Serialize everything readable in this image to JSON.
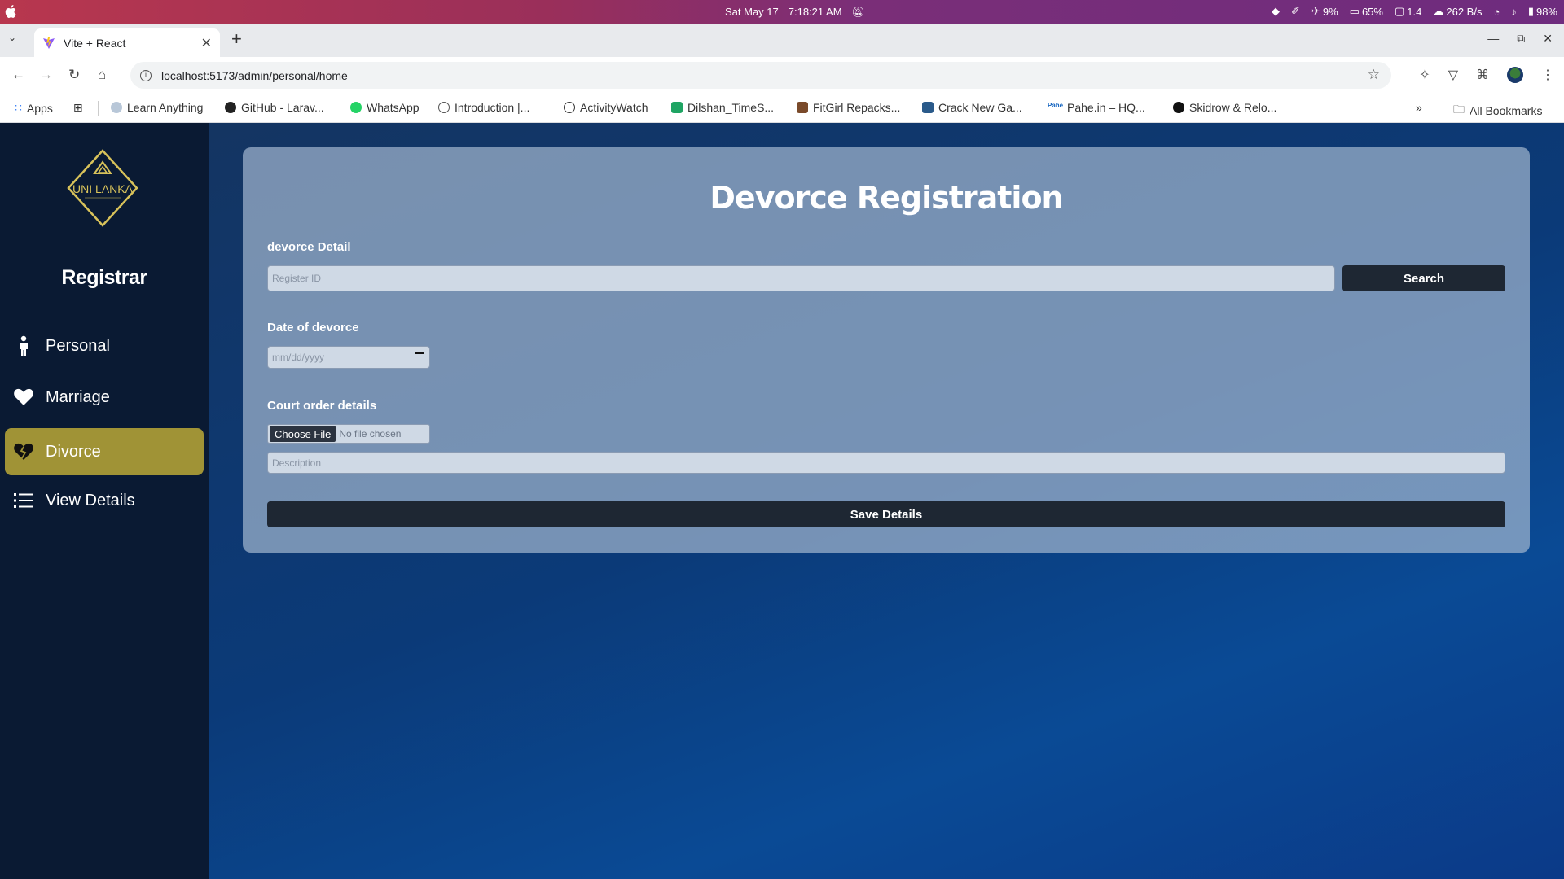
{
  "os": {
    "date": "Sat May 17",
    "time": "7:18:21 AM",
    "cpu": "9%",
    "memory": "65%",
    "load": "1.4",
    "net": "262 B/s",
    "battery": "98%"
  },
  "browser": {
    "tab_title": "Vite + React",
    "url": "localhost:5173/admin/personal/home",
    "bookmarks": [
      "Apps",
      "Learn Anything",
      "GitHub - Larav...",
      "WhatsApp",
      "Introduction |...",
      "ActivityWatch",
      "Dilshan_TimeS...",
      "FitGirl Repacks...",
      "Crack New Ga...",
      "Pahe.in – HQ...",
      "Skidrow & Relo..."
    ],
    "all_bookmarks": "All Bookmarks"
  },
  "sidebar": {
    "logo_text": "UNI LANKA",
    "title": "Registrar",
    "items": [
      {
        "label": "Personal",
        "icon": "person-icon"
      },
      {
        "label": "Marriage",
        "icon": "heart-icon"
      },
      {
        "label": "Divorce",
        "icon": "broken-heart-icon",
        "active": true
      },
      {
        "label": "View Details",
        "icon": "list-icon"
      }
    ]
  },
  "form": {
    "title": "Devorce Registration",
    "detail_label": "devorce Detail",
    "register_placeholder": "Register ID",
    "search_label": "Search",
    "date_label": "Date of devorce",
    "date_placeholder": "mm/dd/yyyy",
    "court_label": "Court order details",
    "choose_file": "Choose File",
    "no_file": "No file chosen",
    "description_placeholder": "Description",
    "save_label": "Save Details"
  },
  "colors": {
    "sidebar_bg": "#0a1a33",
    "active_item": "#a09336",
    "button_dark": "#1e2733"
  }
}
